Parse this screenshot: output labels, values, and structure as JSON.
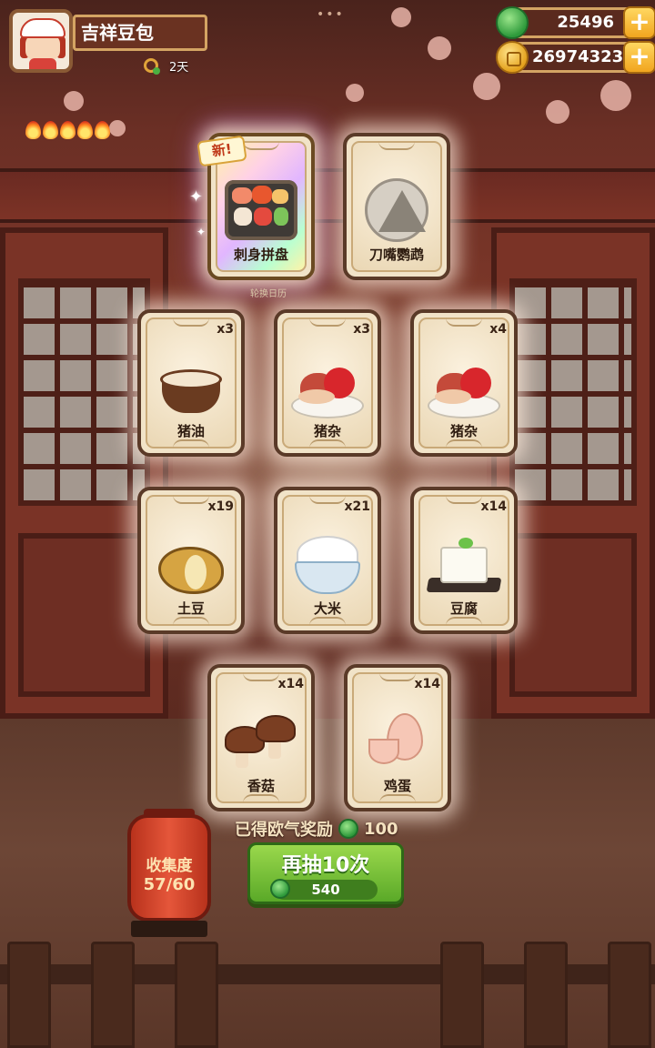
{
  "player": {
    "name": "吉祥豆包",
    "days": "2天"
  },
  "resources": {
    "jade": "25496",
    "gold": "26974323"
  },
  "special_cards": [
    {
      "name": "刺身拼盘",
      "new_tag": "新!",
      "flames": 5
    },
    {
      "name": "刀嘴鹦鹉"
    }
  ],
  "rotation_label": "轮换日历",
  "cards": [
    {
      "name": "猪油",
      "count": "x3"
    },
    {
      "name": "猪杂",
      "count": "x3"
    },
    {
      "name": "猪杂",
      "count": "x4"
    },
    {
      "name": "土豆",
      "count": "x19"
    },
    {
      "name": "大米",
      "count": "x21"
    },
    {
      "name": "豆腐",
      "count": "x14"
    },
    {
      "name": "香菇",
      "count": "x14"
    },
    {
      "name": "鸡蛋",
      "count": "x14"
    }
  ],
  "reward": {
    "label": "已得欧气奖励",
    "value": "100"
  },
  "collection": {
    "label": "收集度",
    "progress": "57/60"
  },
  "draw_button": {
    "label": "再抽10次",
    "cost": "540"
  },
  "colors": {
    "accent_green": "#5aa928",
    "frame_gold": "#d4a463",
    "lantern_red": "#e5563a"
  }
}
